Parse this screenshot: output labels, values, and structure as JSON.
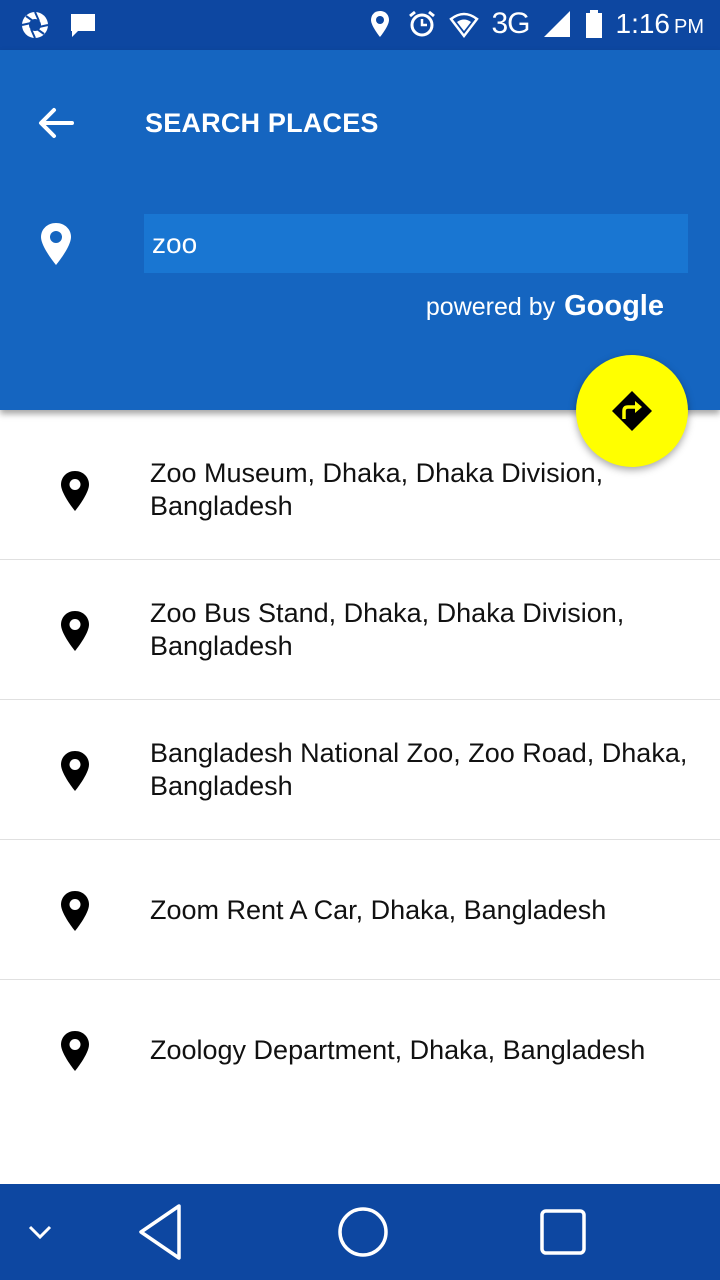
{
  "status_bar": {
    "network": "3G",
    "time": "1:16",
    "ampm": "PM"
  },
  "header": {
    "title": "SEARCH PLACES",
    "back_icon": "arrow-left-icon"
  },
  "search": {
    "value": "zoo",
    "icon": "location-pin-icon"
  },
  "attribution": {
    "prefix": "powered by",
    "brand": "Google"
  },
  "fab": {
    "icon": "directions-icon",
    "color": "#ffff00"
  },
  "results": [
    {
      "line1": "Zoo Museum, Dhaka, Dhaka Division,",
      "line2": "Bangladesh"
    },
    {
      "line1": "Zoo Bus Stand, Dhaka, Dhaka Division,",
      "line2": "Bangladesh"
    },
    {
      "line1": "Bangladesh National Zoo, Zoo Road, Dhaka,",
      "line2": "Bangladesh"
    },
    {
      "line1": "Zoom Rent A Car, Dhaka, Bangladesh",
      "line2": ""
    },
    {
      "line1": "Zoology Department, Dhaka, Bangladesh",
      "line2": ""
    }
  ],
  "colors": {
    "status_bar": "#0d47a1",
    "header": "#1565c0",
    "search_field": "#1976d2",
    "nav_bar": "#0d47a1"
  }
}
